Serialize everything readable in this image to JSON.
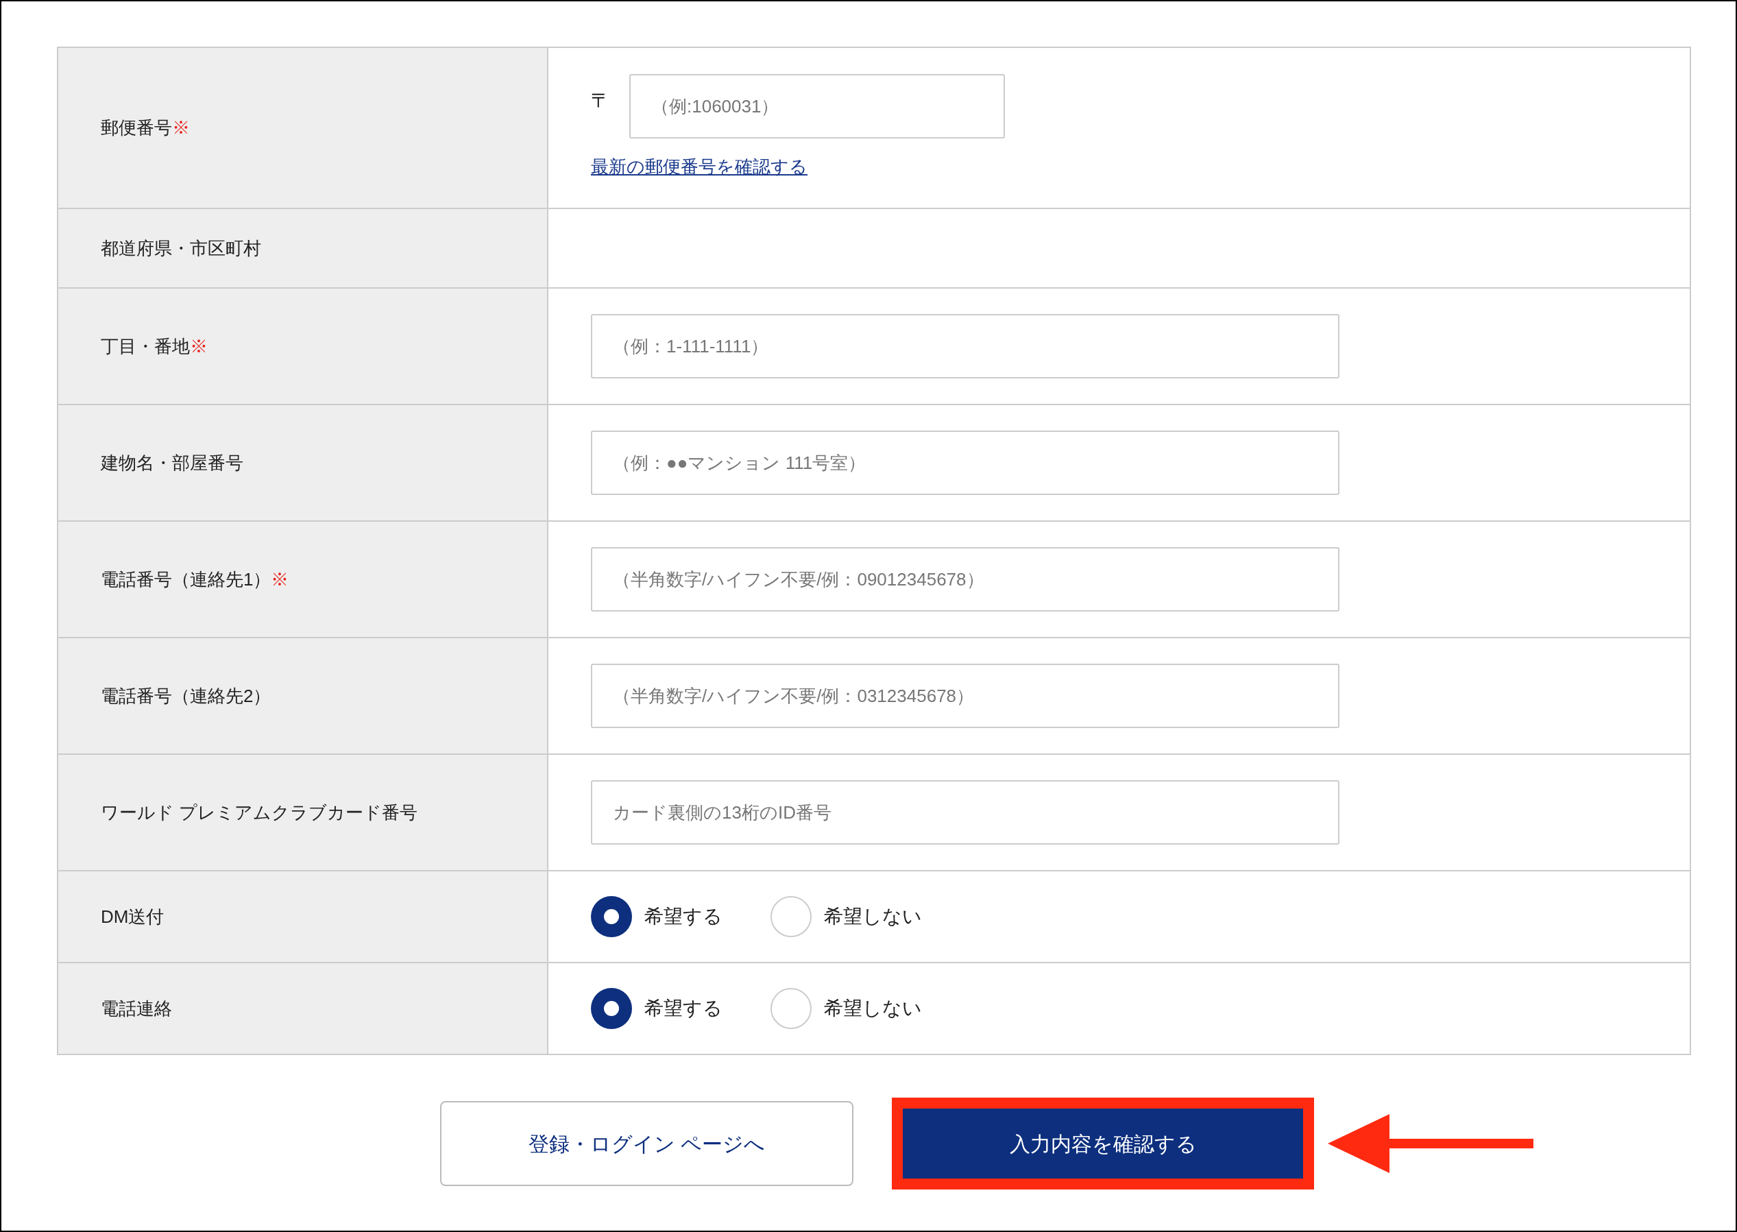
{
  "form": {
    "rows": [
      {
        "kind": "postal",
        "label": "郵便番号",
        "required": true,
        "prefix": "〒",
        "placeholder": "（例:1060031）",
        "link": "最新の郵便番号を確認する"
      },
      {
        "kind": "empty",
        "label": "都道府県・市区町村",
        "required": false
      },
      {
        "kind": "text",
        "label": "丁目・番地",
        "required": true,
        "placeholder": "（例：1-111-1111）"
      },
      {
        "kind": "text",
        "label": "建物名・部屋番号",
        "required": false,
        "placeholder": "（例：●●マンション 111号室）"
      },
      {
        "kind": "text",
        "label": "電話番号（連絡先1）",
        "required": true,
        "placeholder": "（半角数字/ハイフン不要/例：09012345678）"
      },
      {
        "kind": "text",
        "label": "電話番号（連絡先2）",
        "required": false,
        "placeholder": "（半角数字/ハイフン不要/例：0312345678）"
      },
      {
        "kind": "text",
        "label": "ワールド プレミアムクラブカード番号",
        "required": false,
        "placeholder": "カード裏側の13桁のID番号"
      },
      {
        "kind": "radio",
        "label": "DM送付",
        "required": false,
        "options": [
          {
            "label": "希望する",
            "selected": true
          },
          {
            "label": "希望しない",
            "selected": false
          }
        ]
      },
      {
        "kind": "radio",
        "label": "電話連絡",
        "required": false,
        "options": [
          {
            "label": "希望する",
            "selected": true
          },
          {
            "label": "希望しない",
            "selected": false
          }
        ]
      }
    ],
    "required_mark": "※"
  },
  "buttons": {
    "back": "登録・ログイン ページへ",
    "confirm": "入力内容を確認する"
  }
}
